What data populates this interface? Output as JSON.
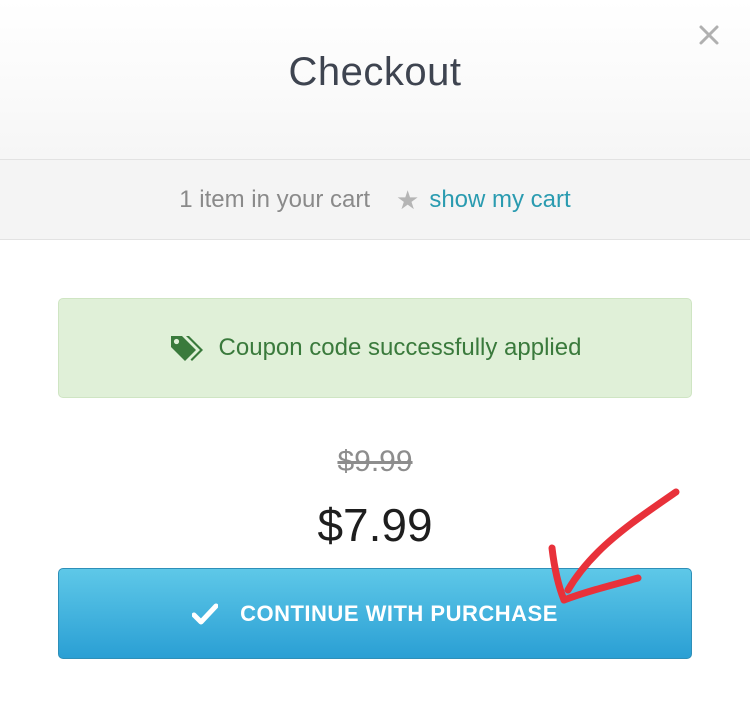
{
  "modal": {
    "title": "Checkout",
    "close_icon": "close-icon"
  },
  "cart": {
    "count_text": "1 item in your cart",
    "star_icon": "star-icon",
    "show_cart_link": "show my cart"
  },
  "coupon": {
    "icon": "tags-icon",
    "message": "Coupon code successfully applied"
  },
  "price": {
    "original": "$9.99",
    "discounted": "$7.99"
  },
  "purchase_button": {
    "icon": "check-icon",
    "label": "CONTINUE WITH PURCHASE"
  },
  "colors": {
    "link": "#2a9bb0",
    "success_bg": "#e0f0d8",
    "success_text": "#3a7a3c",
    "button": "#3ab4e0",
    "annotation": "#e8313a"
  }
}
